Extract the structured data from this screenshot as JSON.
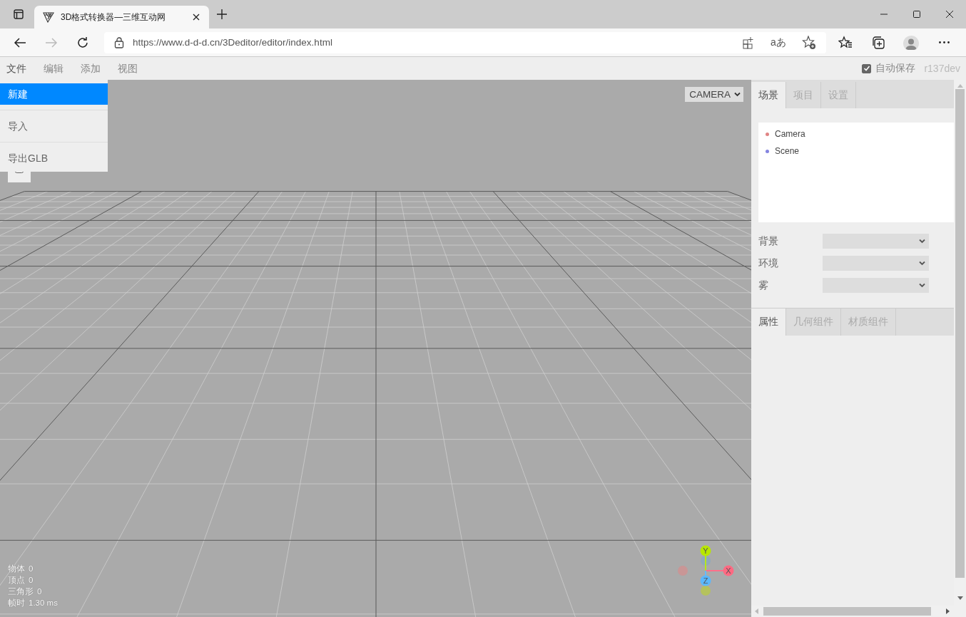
{
  "browser": {
    "tab_title": "3D格式转换器—三维互动网",
    "url": "https://www.d-d-d.cn/3Deditor/editor/index.html",
    "read_aloud_glyph": "aあ"
  },
  "menubar": {
    "menus": [
      {
        "label": "文件",
        "expanded": true
      },
      {
        "label": "编辑",
        "expanded": false
      },
      {
        "label": "添加",
        "expanded": false
      },
      {
        "label": "视图",
        "expanded": false
      }
    ],
    "dropdown": [
      {
        "label": "新建",
        "selected": true
      },
      {
        "label": "导入",
        "selected": false
      },
      {
        "label": "导出GLB",
        "selected": false
      }
    ],
    "autosave": {
      "label": "自动保存",
      "checked": true
    },
    "version": "r137dev"
  },
  "viewport": {
    "camera_select": "CAMERA",
    "stats": [
      {
        "label": "物体",
        "value": "0"
      },
      {
        "label": "顶点",
        "value": "0"
      },
      {
        "label": "三角形",
        "value": "0"
      },
      {
        "label": "帧时",
        "value": "1.30 ms"
      }
    ],
    "gizmo": {
      "x": "X",
      "y": "Y",
      "z": "Z"
    }
  },
  "sidebar": {
    "tabs": [
      {
        "label": "场景",
        "selected": true
      },
      {
        "label": "项目",
        "selected": false
      },
      {
        "label": "设置",
        "selected": false
      }
    ],
    "outliner": [
      {
        "label": "Camera",
        "color": "#e08484"
      },
      {
        "label": "Scene",
        "color": "#8484e0"
      }
    ],
    "fields": [
      {
        "label": "背景"
      },
      {
        "label": "环境"
      },
      {
        "label": "雾"
      }
    ],
    "property_tabs": [
      {
        "label": "属性",
        "selected": true
      },
      {
        "label": "几何组件",
        "selected": false
      },
      {
        "label": "材质组件",
        "selected": false
      }
    ]
  }
}
